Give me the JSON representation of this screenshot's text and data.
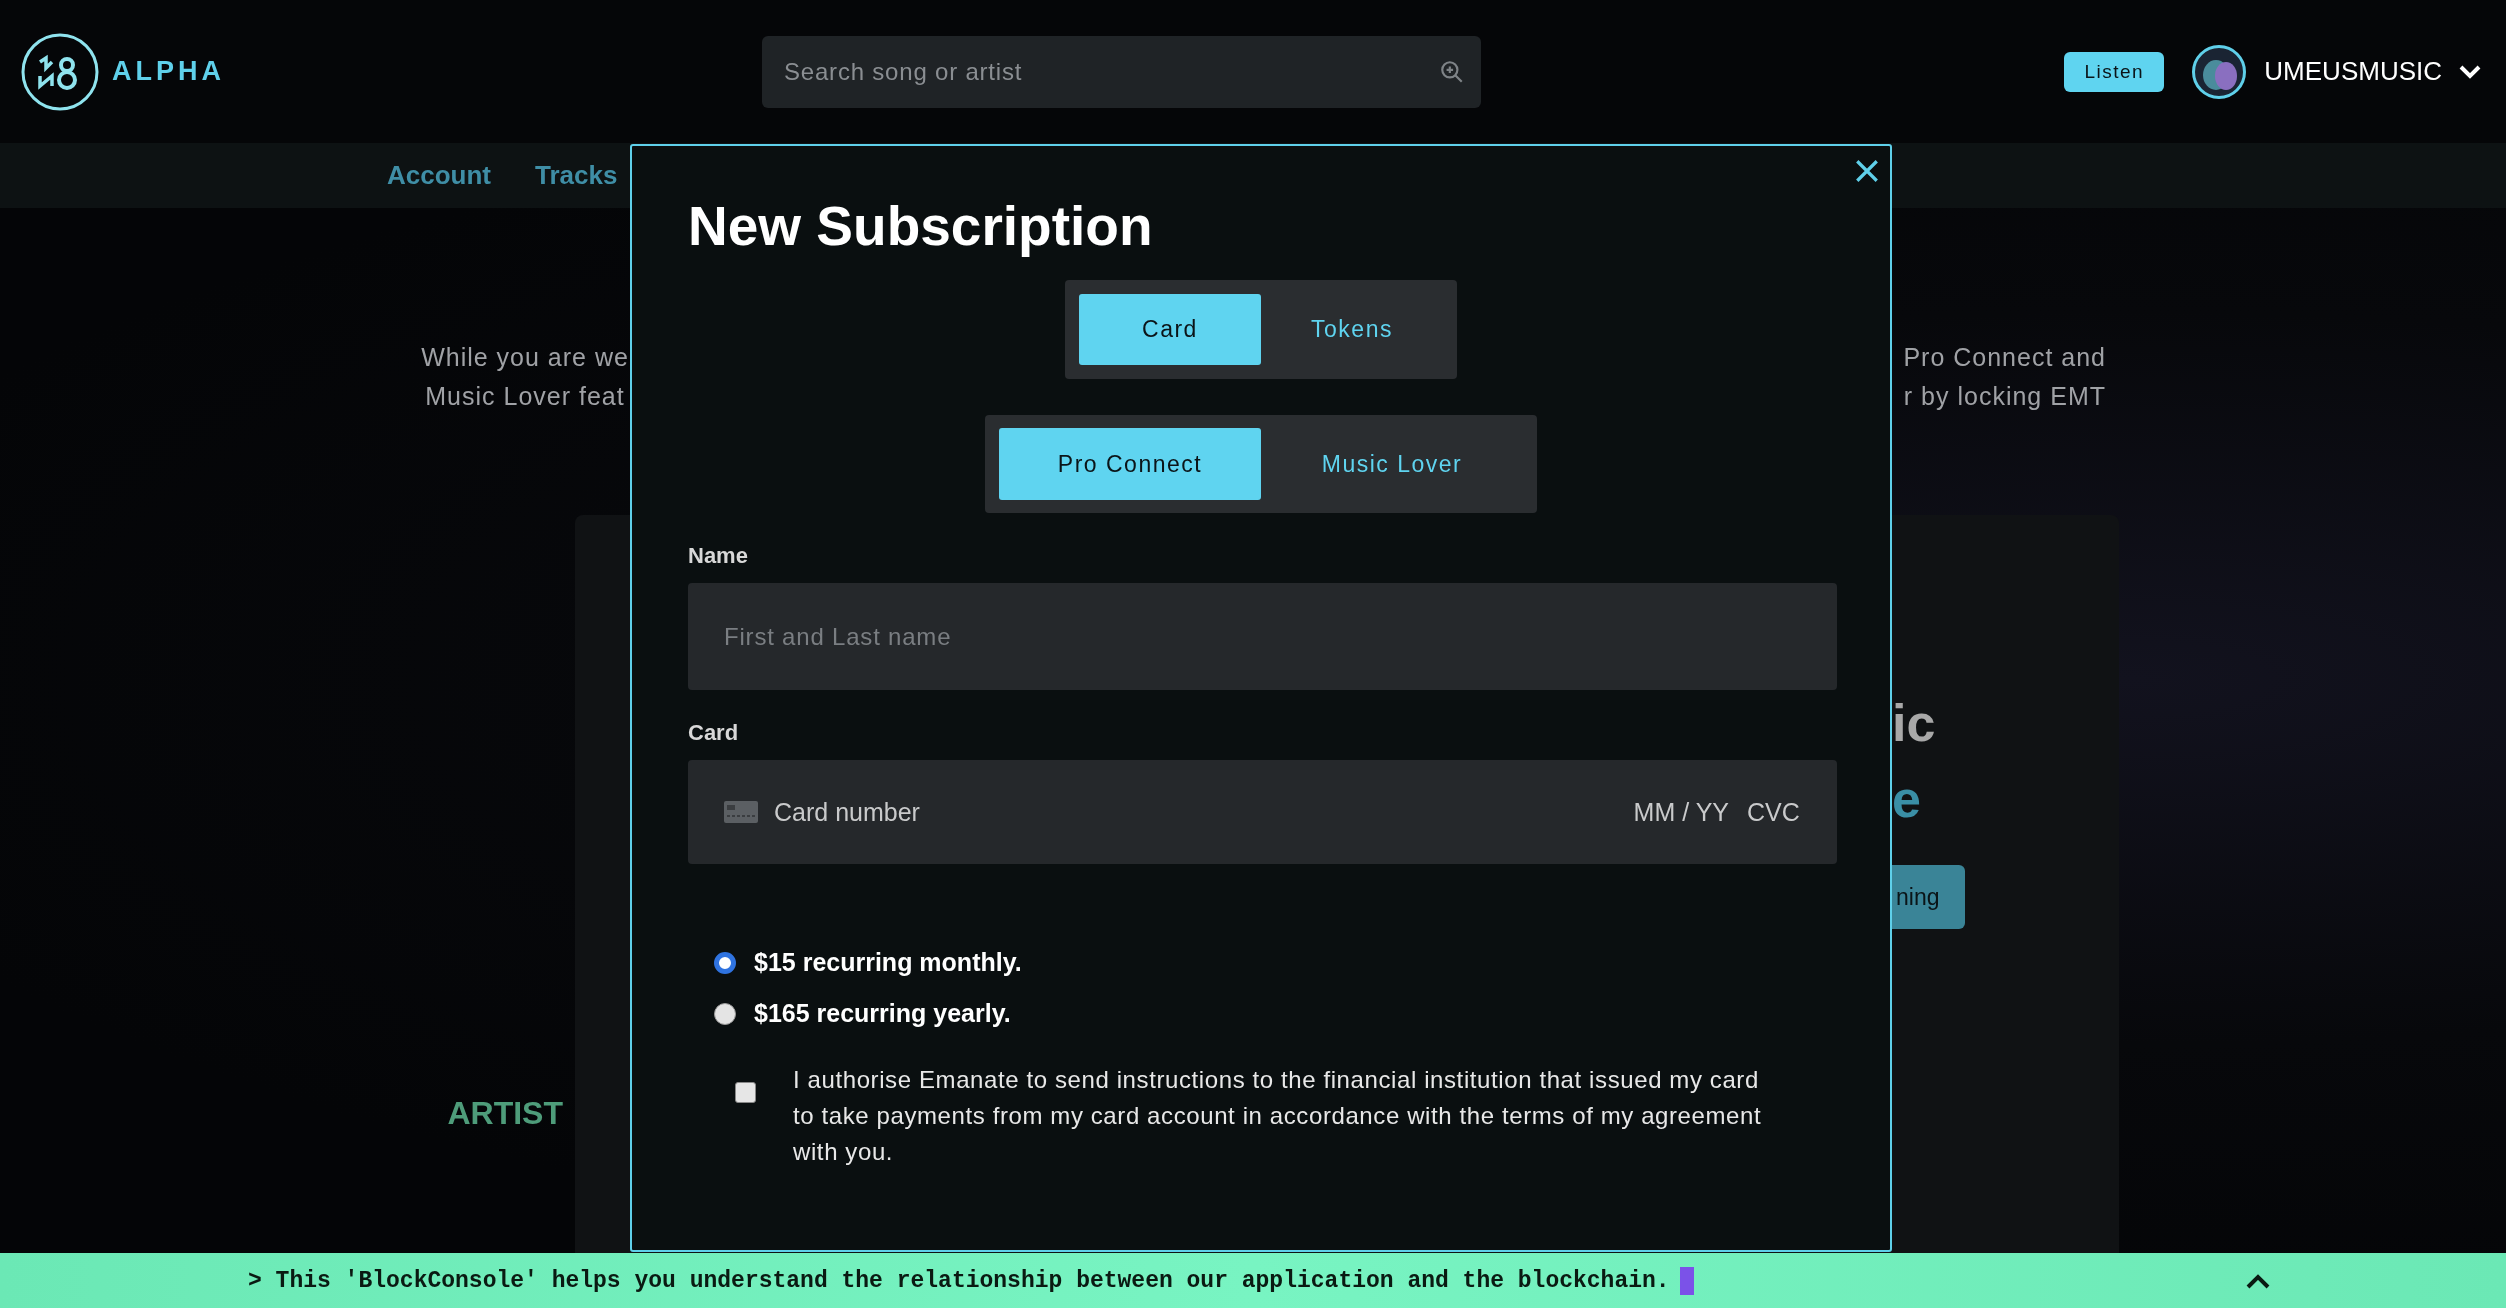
{
  "header": {
    "logo_text": "ALPHA",
    "search": {
      "placeholder": "Search song or artist"
    },
    "listen_button": "Listen",
    "user": {
      "name": "UMEUSMUSIC"
    }
  },
  "nav": {
    "items": [
      {
        "label": "Account"
      },
      {
        "label": "Tracks"
      }
    ]
  },
  "background": {
    "intro_left": [
      "While you are we",
      "Music Lover feat"
    ],
    "intro_right": [
      "Pro Connect and",
      "r by locking EMT"
    ],
    "side_label": "ARTIST",
    "card": {
      "heading_lines": [
        {
          "text": "ic",
          "kind": "plain"
        },
        {
          "text": "e",
          "kind": "accent"
        }
      ],
      "button": "ning"
    }
  },
  "modal": {
    "title": "New Subscription",
    "payment_tabs": [
      {
        "label": "Card",
        "selected": true
      },
      {
        "label": "Tokens",
        "selected": false
      }
    ],
    "plan_tabs": [
      {
        "label": "Pro Connect",
        "selected": true
      },
      {
        "label": "Music Lover",
        "selected": false
      }
    ],
    "name_field": {
      "label": "Name",
      "placeholder": "First and Last name"
    },
    "card_field": {
      "label": "Card",
      "placeholder": "Card number",
      "expiry_placeholder": "MM / YY",
      "cvc_placeholder": "CVC"
    },
    "billing_options": [
      {
        "label": "$15 recurring monthly.",
        "selected": true
      },
      {
        "label": "$165 recurring yearly.",
        "selected": false
      }
    ],
    "authorisation": {
      "text": "I authorise Emanate to send instructions to the financial institution that issued my card to take payments from my card account in accordance with the terms of my agreement with you.",
      "checked": false
    }
  },
  "console": {
    "message": "> This 'BlockConsole' helps you understand the relationship between our application and the blockchain."
  }
}
